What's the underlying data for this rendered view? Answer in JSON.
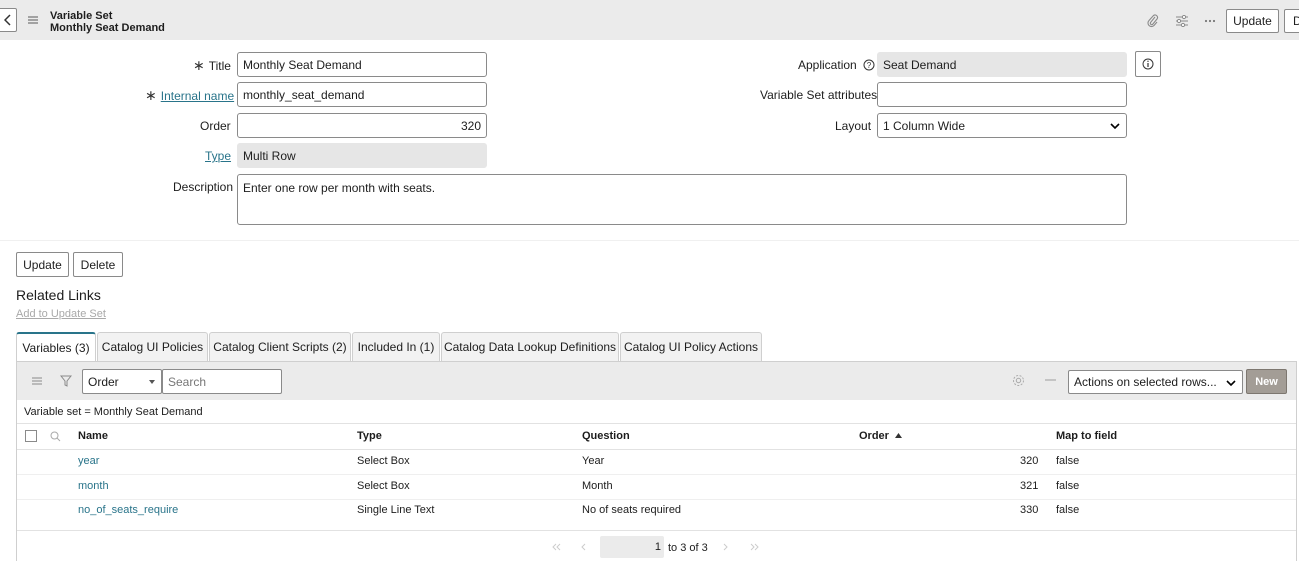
{
  "header": {
    "record_type": "Variable Set",
    "record_name": "Monthly Seat Demand",
    "update_label": "Update",
    "delete_partial_label": "D"
  },
  "form": {
    "title_label": "Title",
    "title_value": "Monthly Seat Demand",
    "internal_name_label": "Internal name",
    "internal_name_value": "monthly_seat_demand",
    "order_label": "Order",
    "order_value": "320",
    "type_label": "Type",
    "type_value": "Multi Row",
    "description_label": "Description",
    "description_value": "Enter one row per month with seats.",
    "application_label": "Application",
    "application_value": "Seat Demand",
    "attributes_label": "Variable Set attributes",
    "attributes_value": "",
    "layout_label": "Layout",
    "layout_value": "1 Column Wide"
  },
  "actions": {
    "update_label": "Update",
    "delete_label": "Delete"
  },
  "related": {
    "heading": "Related Links",
    "add_to_update_set": "Add to Update Set"
  },
  "tabs": [
    {
      "label": "Variables (3)",
      "active": true
    },
    {
      "label": "Catalog UI Policies",
      "active": false
    },
    {
      "label": "Catalog Client Scripts (2)",
      "active": false
    },
    {
      "label": "Included In (1)",
      "active": false
    },
    {
      "label": "Catalog Data Lookup Definitions",
      "active": false
    },
    {
      "label": "Catalog UI Policy Actions",
      "active": false
    }
  ],
  "list": {
    "filter_field": "Order",
    "search_placeholder": "Search",
    "actions_select": "Actions on selected rows...",
    "new_label": "New",
    "breadcrumb": "Variable set = Monthly Seat Demand",
    "columns": [
      "Name",
      "Type",
      "Question",
      "Order",
      "Map to field"
    ],
    "rows": [
      {
        "name": "year",
        "type": "Select Box",
        "question": "Year",
        "order": "320",
        "map": "false"
      },
      {
        "name": "month",
        "type": "Select Box",
        "question": "Month",
        "order": "321",
        "map": "false"
      },
      {
        "name": "no_of_seats_require",
        "type": "Single Line Text",
        "question": "No of seats required",
        "order": "330",
        "map": "false"
      }
    ],
    "pagination": {
      "current": "1",
      "range_text": "to 3 of 3"
    }
  }
}
